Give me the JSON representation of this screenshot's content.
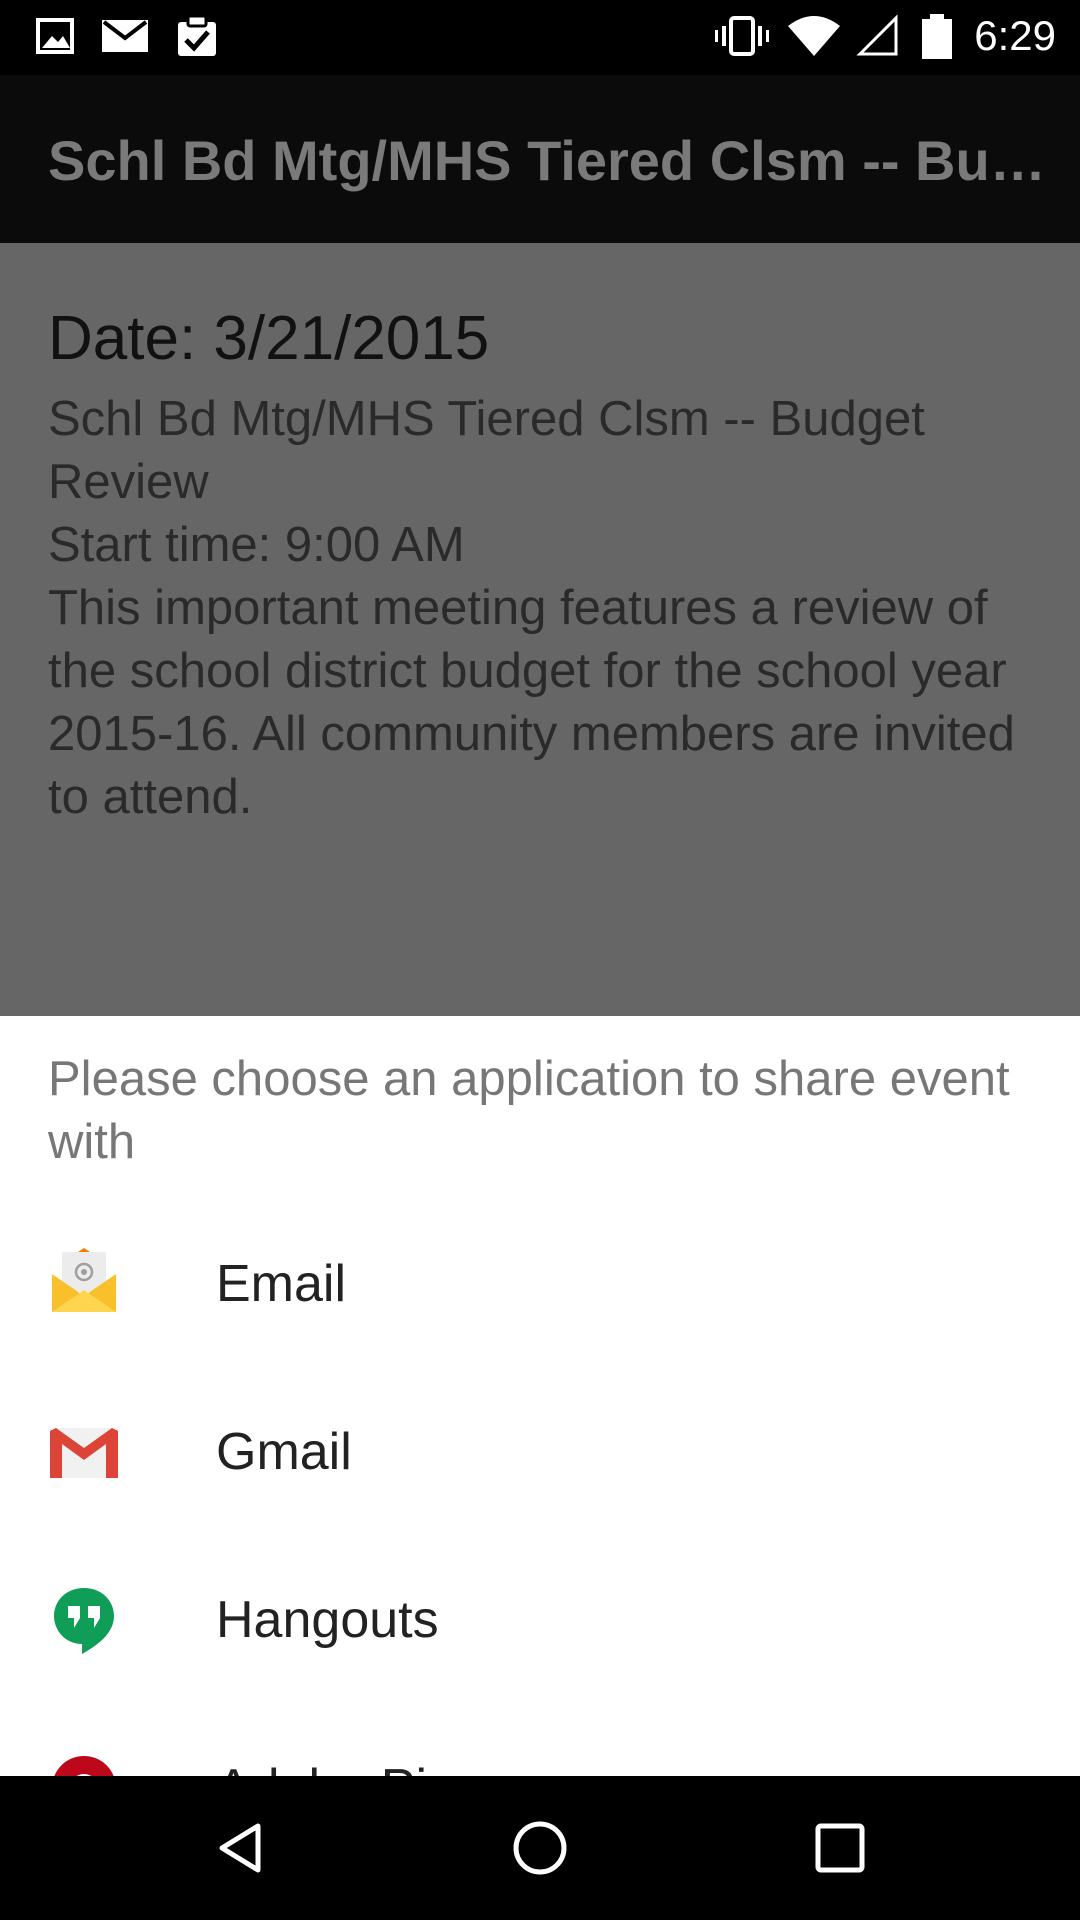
{
  "status_bar": {
    "time": "6:29",
    "left_icons": [
      "image-icon",
      "mail-icon",
      "clipboard-check-icon"
    ],
    "right_icons": [
      "vibrate-icon",
      "wifi-icon",
      "signal-icon",
      "battery-icon"
    ]
  },
  "app_bar": {
    "title": "Schl Bd Mtg/MHS Tiered Clsm -- Budget Review"
  },
  "event": {
    "date": "Date: 3/21/2015",
    "title": "Schl Bd Mtg/MHS Tiered Clsm -- Budget Review",
    "start_time": "Start time: 9:00 AM",
    "description": "This important meeting features a review of the school district budget for the school year 2015-16. All community members are invited to attend."
  },
  "share_sheet": {
    "prompt": "Please choose an application to share event with",
    "apps": [
      {
        "label": "Email",
        "icon": "email-app-icon"
      },
      {
        "label": "Gmail",
        "icon": "gmail-icon"
      },
      {
        "label": "Hangouts",
        "icon": "hangouts-icon"
      },
      {
        "label": "Adobe Pi...",
        "icon": "pinterest-icon"
      }
    ]
  },
  "nav_bar": {
    "buttons": [
      "back-icon",
      "home-icon",
      "recents-icon"
    ]
  },
  "colors": {
    "gmail_red": "#DB4437",
    "hangouts_green": "#0F9D58",
    "email_yellow": "#F9C02B",
    "pinterest_red": "#BD081C"
  }
}
